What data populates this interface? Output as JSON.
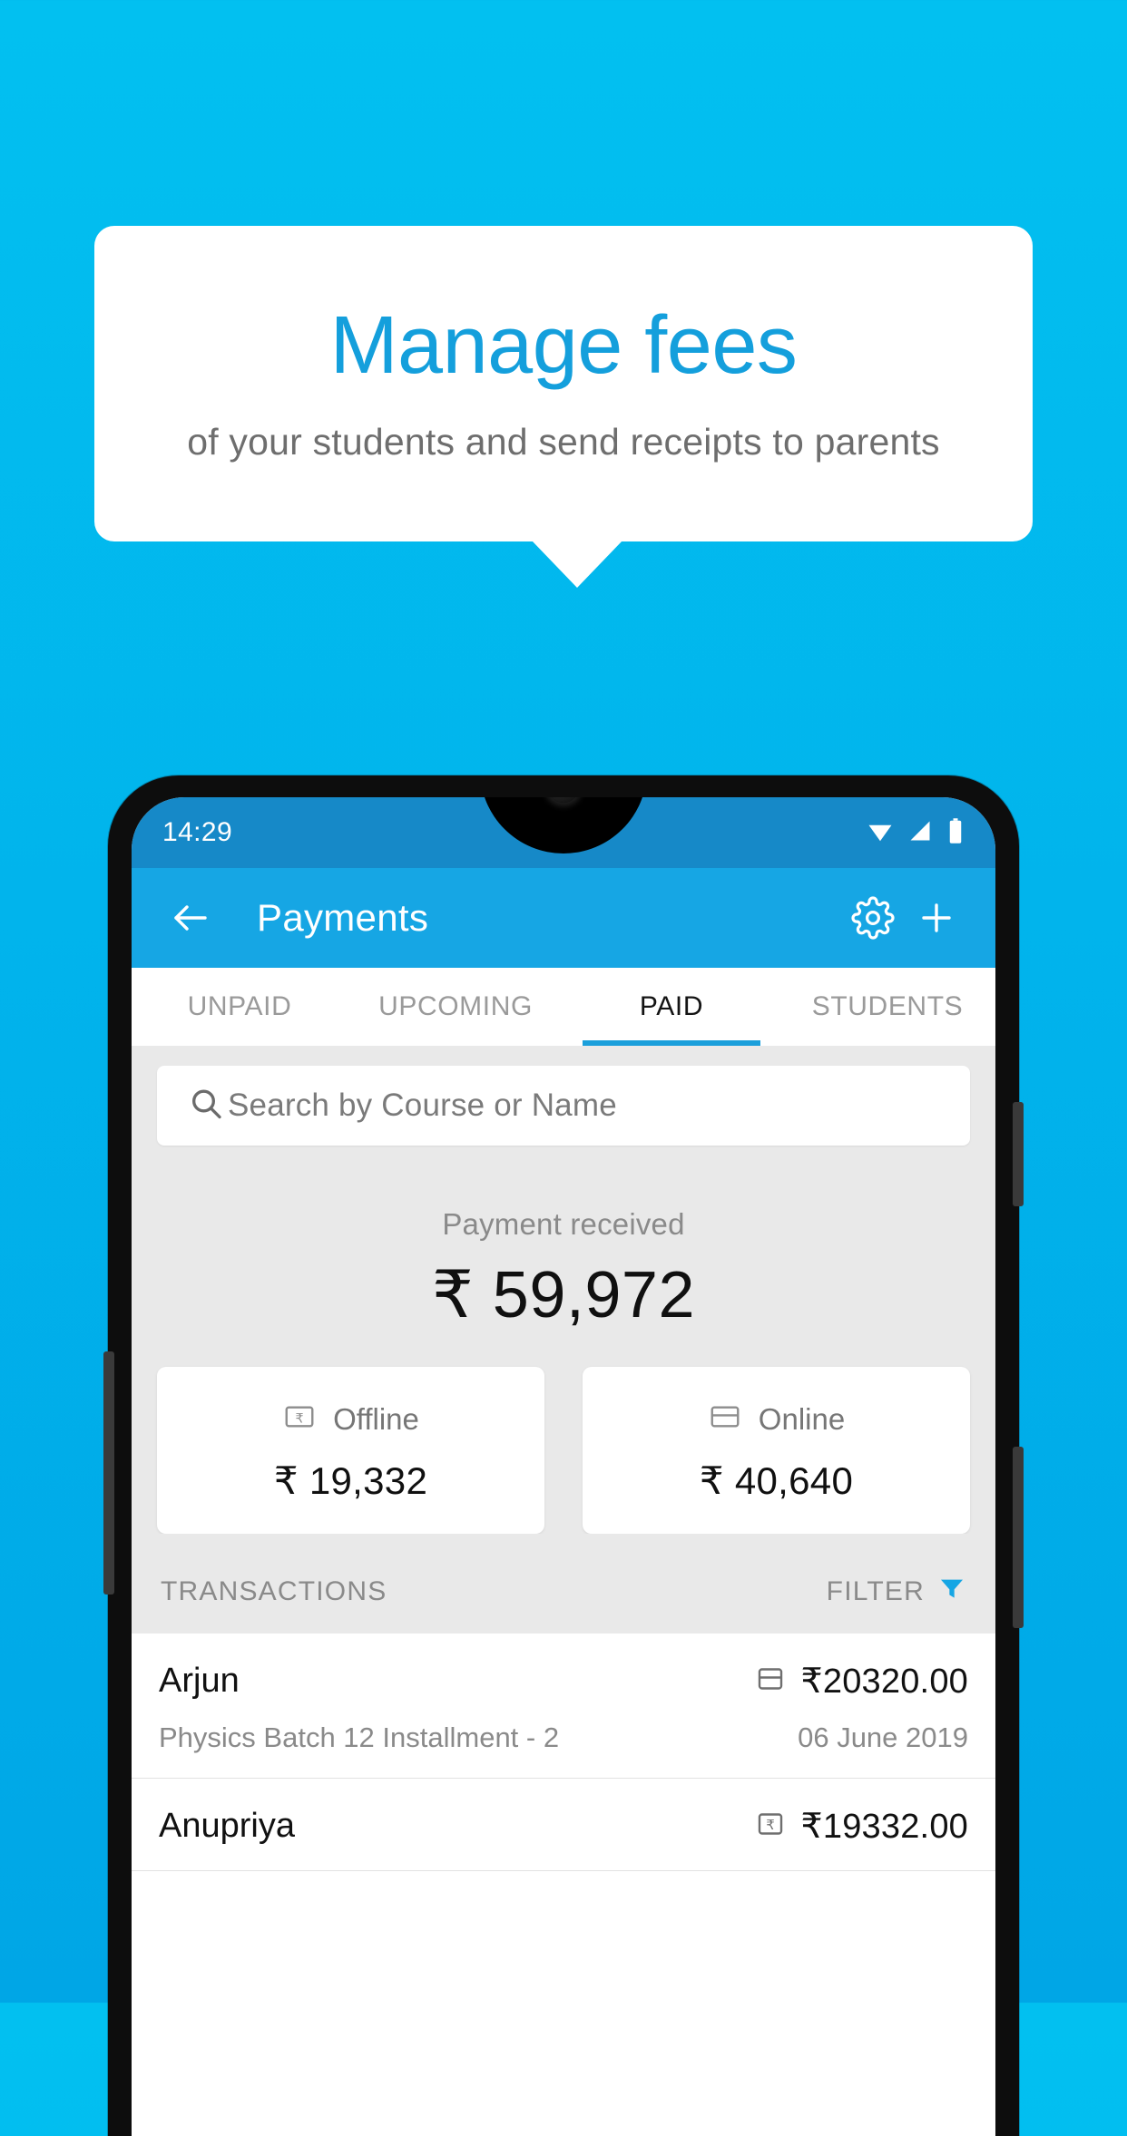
{
  "promo": {
    "title": "Manage fees",
    "subtitle": "of your students and send receipts to parents",
    "bg_color_top": "#02C0F0",
    "bg_color_bottom": "#00A6E6",
    "title_color": "#149FDC"
  },
  "phone": {
    "statusbar": {
      "time": "14:29",
      "icons": [
        "wifi-icon",
        "signal-icon",
        "battery-icon"
      ],
      "bg_color": "#1689C8"
    },
    "appbar": {
      "back_icon": "arrow-left-icon",
      "title": "Payments",
      "settings_icon": "gear-icon",
      "add_icon": "plus-icon",
      "bg_color": "#16A6E4"
    },
    "tabs": [
      {
        "label": "UNPAID",
        "active": false
      },
      {
        "label": "UPCOMING",
        "active": false
      },
      {
        "label": "PAID",
        "active": true
      },
      {
        "label": "STUDENTS",
        "active": false
      }
    ],
    "tab_indicator_color": "#1B9FDB",
    "search": {
      "icon": "search-icon",
      "placeholder": "Search by Course or Name",
      "value": ""
    },
    "summary": {
      "label": "Payment received",
      "amount": "₹ 59,972"
    },
    "cards": [
      {
        "icon": "banknote-rupee-icon",
        "label": "Offline",
        "value": "₹ 19,332"
      },
      {
        "icon": "credit-card-icon",
        "label": "Online",
        "value": "₹ 40,640"
      }
    ],
    "transactions_header": {
      "left_label": "TRANSACTIONS",
      "right_label": "FILTER",
      "filter_icon": "funnel-icon",
      "filter_icon_color": "#16A6E4"
    },
    "transactions": [
      {
        "name": "Arjun",
        "method_icon": "credit-card-icon",
        "amount": "₹20320.00",
        "description": "Physics Batch 12 Installment - 2",
        "date": "06 June 2019"
      },
      {
        "name": "Anupriya",
        "method_icon": "banknote-rupee-icon",
        "amount": "₹19332.00",
        "description": "",
        "date": ""
      }
    ]
  }
}
